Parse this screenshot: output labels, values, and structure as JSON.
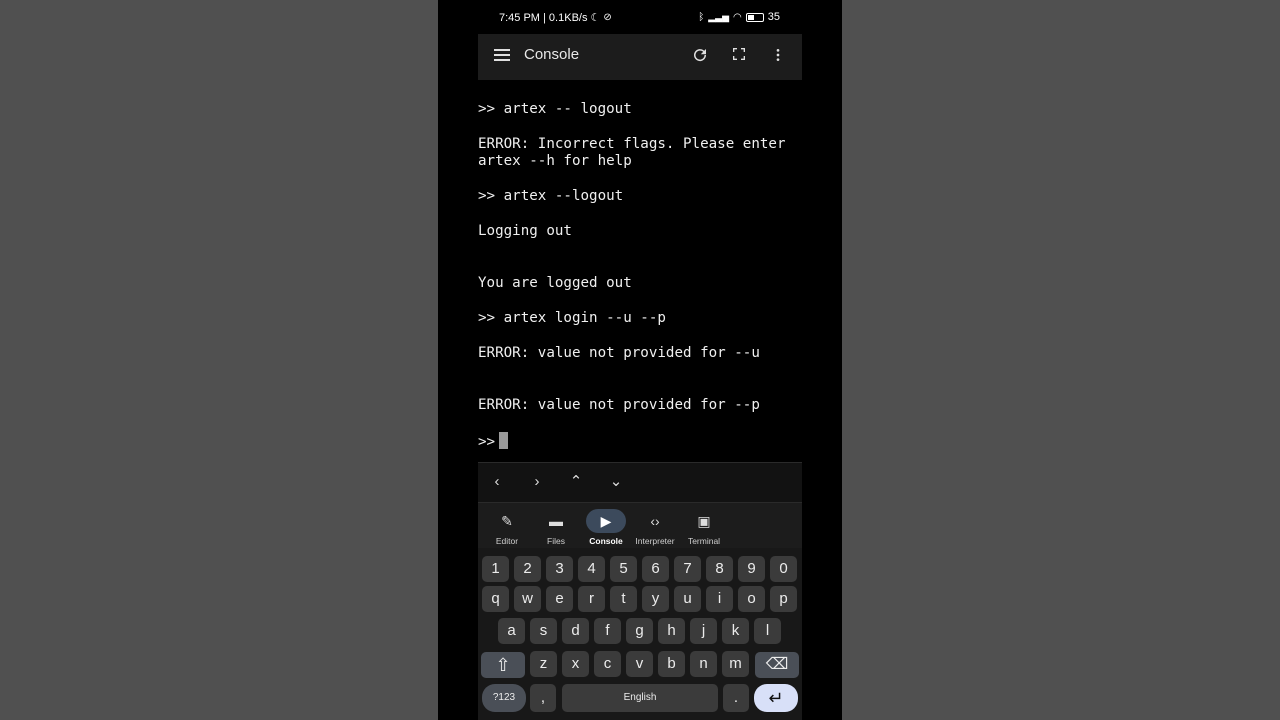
{
  "status_bar": {
    "time_info": "7:45 PM | 0.1KB/s",
    "battery": "35"
  },
  "app_bar": {
    "title": "Console",
    "menu_icon": "hamburger-menu-icon",
    "refresh_icon": "refresh-icon",
    "fullscreen_icon": "fullscreen-icon",
    "more_icon": "more-vert-icon"
  },
  "console": {
    "lines": [
      ">> artex -- logout",
      "ERROR: Incorrect flags. Please enter",
      "artex --h for help",
      ">> artex --logout",
      "Logging out",
      "You are logged out",
      ">> artex login --u --p",
      "ERROR: value not provided for --u",
      "ERROR: value not provided for --p",
      ">>"
    ]
  },
  "nav_arrows": [
    "‹",
    "›",
    "⌃",
    "⌄"
  ],
  "tabs": [
    {
      "label": "Editor",
      "icon": "pencil-icon",
      "glyph": "✎"
    },
    {
      "label": "Files",
      "icon": "folder-icon",
      "glyph": "▬"
    },
    {
      "label": "Console",
      "icon": "play-icon",
      "glyph": "▶"
    },
    {
      "label": "Interpreter",
      "icon": "code-icon",
      "glyph": "‹›"
    },
    {
      "label": "Terminal",
      "icon": "terminal-icon",
      "glyph": "▣"
    }
  ],
  "active_tab": "Console",
  "keyboard": {
    "row_numbers": [
      "1",
      "2",
      "3",
      "4",
      "5",
      "6",
      "7",
      "8",
      "9",
      "0"
    ],
    "row_top": [
      "q",
      "w",
      "e",
      "r",
      "t",
      "y",
      "u",
      "i",
      "o",
      "p"
    ],
    "row_middle": [
      "a",
      "s",
      "d",
      "f",
      "g",
      "h",
      "j",
      "k",
      "l"
    ],
    "row_bottom": [
      "z",
      "x",
      "c",
      "v",
      "b",
      "n",
      "m"
    ],
    "symbols_key": "?123",
    "comma_key": ",",
    "space_key": "English",
    "period_key": ".",
    "shift_glyph": "⇧",
    "backspace_glyph": "⌫",
    "enter_glyph": "↵"
  }
}
